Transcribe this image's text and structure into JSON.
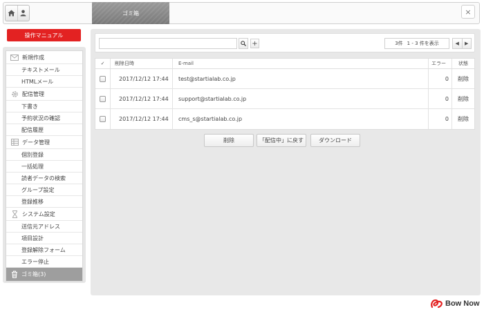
{
  "header": {
    "tab_title": "ゴミ箱",
    "home_icon": "home-icon",
    "user_icon": "user-icon",
    "close_label": "×"
  },
  "manual_button": "操作マニュアル",
  "sidebar": {
    "sections": [
      {
        "icon": "mail-icon",
        "label": "新規作成",
        "items": [
          "テキストメール",
          "HTMLメール"
        ]
      },
      {
        "icon": "gear-icon",
        "label": "配信管理",
        "items": [
          "下書き",
          "予約状況の確認",
          "配信履歴"
        ]
      },
      {
        "icon": "table-icon",
        "label": "データ管理",
        "items": [
          "個別登録",
          "一括処理",
          "読者データの検索",
          "グループ設定",
          "登録推移"
        ]
      },
      {
        "icon": "hourglass-icon",
        "label": "システム設定",
        "items": [
          "送信元アドレス",
          "項目設計",
          "登録解除フォーム",
          "エラー停止"
        ]
      }
    ],
    "trash": {
      "icon": "trash-icon",
      "label": "ゴミ箱(3)"
    }
  },
  "toolbar": {
    "search_placeholder": "",
    "count_total": "3件",
    "count_range": "1 - 3 件を表示",
    "prev_label": "◀",
    "next_label": "▶"
  },
  "table": {
    "headers": {
      "check": "✓",
      "date": "削除日時",
      "email": "E-mail",
      "error": "エラー",
      "status": "状態"
    },
    "rows": [
      {
        "date": "2017/12/12 17:44",
        "email": "test@startialab.co.jp",
        "error": "0",
        "status": "削除"
      },
      {
        "date": "2017/12/12 17:44",
        "email": "support@startialab.co.jp",
        "error": "0",
        "status": "削除"
      },
      {
        "date": "2017/12/12 17:44",
        "email": "cms_s@startialab.co.jp",
        "error": "0",
        "status": "削除"
      }
    ]
  },
  "actions": {
    "delete": "削除",
    "restore": "「配信中」に戻す",
    "download": "ダウンロード"
  },
  "brand": {
    "name": "Bow Now",
    "logo_icon": "bownow-logo-icon",
    "color": "#e32222"
  }
}
